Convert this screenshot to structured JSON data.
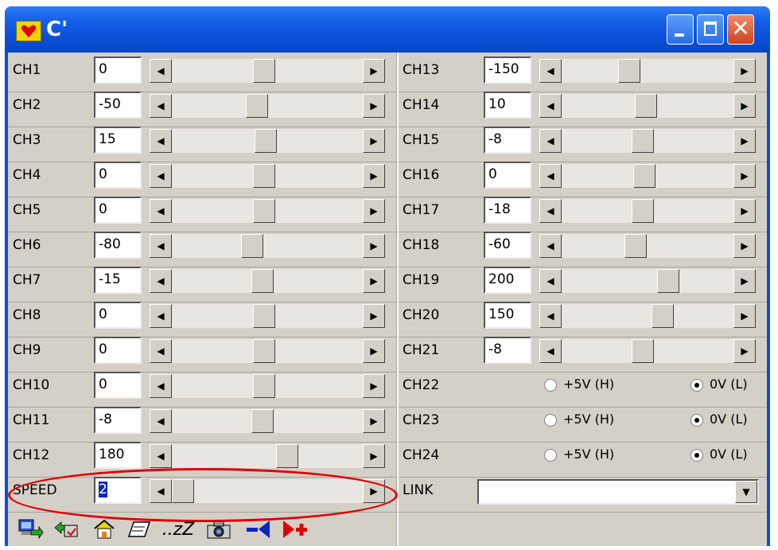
{
  "window": {
    "title": "C'"
  },
  "left_channels": [
    {
      "label": "CH1",
      "value": "0",
      "level": 0.48
    },
    {
      "label": "CH2",
      "value": "-50",
      "level": 0.44
    },
    {
      "label": "CH3",
      "value": "15",
      "level": 0.49
    },
    {
      "label": "CH4",
      "value": "0",
      "level": 0.48
    },
    {
      "label": "CH5",
      "value": "0",
      "level": 0.48
    },
    {
      "label": "CH6",
      "value": "-80",
      "level": 0.41
    },
    {
      "label": "CH7",
      "value": "-15",
      "level": 0.47
    },
    {
      "label": "CH8",
      "value": "0",
      "level": 0.48
    },
    {
      "label": "CH9",
      "value": "0",
      "level": 0.48
    },
    {
      "label": "CH10",
      "value": "0",
      "level": 0.48
    },
    {
      "label": "CH11",
      "value": "-8",
      "level": 0.47
    },
    {
      "label": "CH12",
      "value": "180",
      "level": 0.62
    }
  ],
  "right_channels": [
    {
      "label": "CH13",
      "value": "-150",
      "level": 0.38
    },
    {
      "label": "CH14",
      "value": "10",
      "level": 0.49
    },
    {
      "label": "CH15",
      "value": "-8",
      "level": 0.47
    },
    {
      "label": "CH16",
      "value": "0",
      "level": 0.48
    },
    {
      "label": "CH17",
      "value": "-18",
      "level": 0.47
    },
    {
      "label": "CH18",
      "value": "-60",
      "level": 0.42
    },
    {
      "label": "CH19",
      "value": "200",
      "level": 0.64
    },
    {
      "label": "CH20",
      "value": "150",
      "level": 0.6
    },
    {
      "label": "CH21",
      "value": "-8",
      "level": 0.47
    }
  ],
  "digital_channels": [
    {
      "label": "CH22",
      "opt_high": "+5V (H)",
      "opt_low": "0V (L)",
      "selected": "low"
    },
    {
      "label": "CH23",
      "opt_high": "+5V (H)",
      "opt_low": "0V (L)",
      "selected": "low"
    },
    {
      "label": "CH24",
      "opt_high": "+5V (H)",
      "opt_low": "0V (L)",
      "selected": "low"
    }
  ],
  "speed": {
    "label": "SPEED",
    "value": "2",
    "level": 0.0
  },
  "link": {
    "label": "LINK",
    "value": ""
  },
  "toolbar_icons": [
    "transfer-icon",
    "refresh-icon",
    "home-icon",
    "erase-icon",
    "sleep-icon",
    "camera-icon",
    "remove-icon",
    "add-icon"
  ],
  "toolbar_sleep_text": "..zZ",
  "colors": {
    "title_bar": "#0a4fd8",
    "client": "#d4d0c8",
    "highlight": "#e00000"
  }
}
